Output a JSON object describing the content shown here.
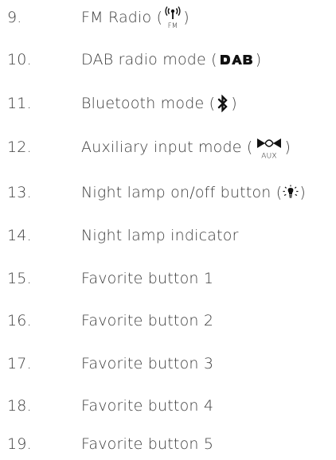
{
  "items": [
    {
      "number": "9.",
      "text_before": "FM Radio (",
      "icon": "fm-antenna-icon",
      "icon_caption": "FM",
      "text_after": ")"
    },
    {
      "number": "10.",
      "text_before": "DAB radio mode (",
      "icon": "dab-logo-icon",
      "text_after": ")"
    },
    {
      "number": "11.",
      "text_before": "Bluetooth mode (",
      "icon": "bluetooth-icon",
      "text_after": ")"
    },
    {
      "number": "12.",
      "text_before": "Auxiliary input mode (",
      "icon": "aux-input-icon",
      "icon_caption": "AUX",
      "text_after": ")"
    },
    {
      "number": "13.",
      "text_before": "Night lamp on/off button (",
      "icon": "night-lamp-icon",
      "text_after": ")"
    },
    {
      "number": "14.",
      "text_before": "Night lamp indicator"
    },
    {
      "number": "15.",
      "text_before": "Favorite button 1"
    },
    {
      "number": "16.",
      "text_before": "Favorite button 2"
    },
    {
      "number": "17.",
      "text_before": "Favorite button 3"
    },
    {
      "number": "18.",
      "text_before": "Favorite button 4"
    },
    {
      "number": "19.",
      "text_before": "Favorite button 5"
    }
  ],
  "colors": {
    "text": "#3d3d3d",
    "icon": "#111111"
  }
}
